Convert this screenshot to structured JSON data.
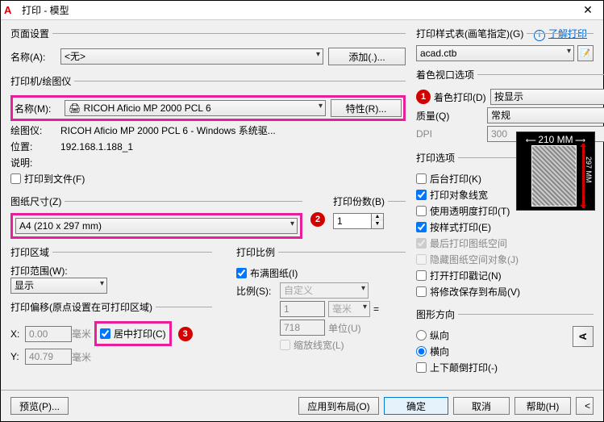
{
  "window": {
    "title": "打印 - 模型"
  },
  "link": {
    "learn": "了解打印"
  },
  "pageSetup": {
    "legend": "页面设置",
    "name_lbl": "名称(A):",
    "name_value": "<无>",
    "add_btn": "添加(.)..."
  },
  "printer": {
    "legend": "打印机/绘图仪",
    "name_lbl": "名称(M):",
    "name_value": "RICOH Aficio MP 2000 PCL 6",
    "props_btn": "特性(R)...",
    "plotter_lbl": "绘图仪:",
    "plotter_val": "RICOH Aficio MP 2000 PCL 6 - Windows 系统驱...",
    "pos_lbl": "位置:",
    "pos_val": "192.168.1.188_1",
    "desc_lbl": "说明:",
    "tofile": "打印到文件(F)"
  },
  "preview": {
    "w": "210 MM",
    "h": "297 MM"
  },
  "paper": {
    "legend": "图纸尺寸(Z)",
    "value": "A4 (210 x 297 mm)"
  },
  "copies": {
    "legend": "打印份数(B)",
    "value": "1"
  },
  "area": {
    "legend": "打印区域",
    "range_lbl": "打印范围(W):",
    "range_val": "显示"
  },
  "scale": {
    "legend": "打印比例",
    "fit": "布满图纸(I)",
    "ratio_lbl": "比例(S):",
    "ratio_val": "自定义",
    "n1": "1",
    "unit1": "毫米",
    "unit_lbl": "单位(U)",
    "n2": "718",
    "scaleLines": "缩放线宽(L)"
  },
  "offset": {
    "legend": "打印偏移(原点设置在可打印区域)",
    "x_lbl": "X:",
    "x_val": "0.00",
    "y_lbl": "Y:",
    "y_val": "40.79",
    "mm": "毫米",
    "center": "居中打印(C)"
  },
  "styleTable": {
    "legend": "打印样式表(画笔指定)(G)",
    "value": "acad.ctb"
  },
  "viewport": {
    "legend": "着色视口选项",
    "shade_lbl": "着色打印(D)",
    "shade_val": "按显示",
    "quality_lbl": "质量(Q)",
    "quality_val": "常规",
    "dpi_lbl": "DPI",
    "dpi_val": "300"
  },
  "options": {
    "legend": "打印选项",
    "o1": "后台打印(K)",
    "o2": "打印对象线宽",
    "o3": "使用透明度打印(T)",
    "o4": "按样式打印(E)",
    "o5": "最后打印图纸空间",
    "o6": "隐藏图纸空间对象(J)",
    "o7": "打开打印戳记(N)",
    "o8": "将修改保存到布局(V)"
  },
  "orient": {
    "legend": "图形方向",
    "portrait": "纵向",
    "landscape": "横向",
    "upside": "上下颠倒打印(-)"
  },
  "footer": {
    "preview": "预览(P)...",
    "apply": "应用到布局(O)",
    "ok": "确定",
    "cancel": "取消",
    "help": "帮助(H)"
  },
  "markers": {
    "m1": "1",
    "m2": "2",
    "m3": "3"
  }
}
